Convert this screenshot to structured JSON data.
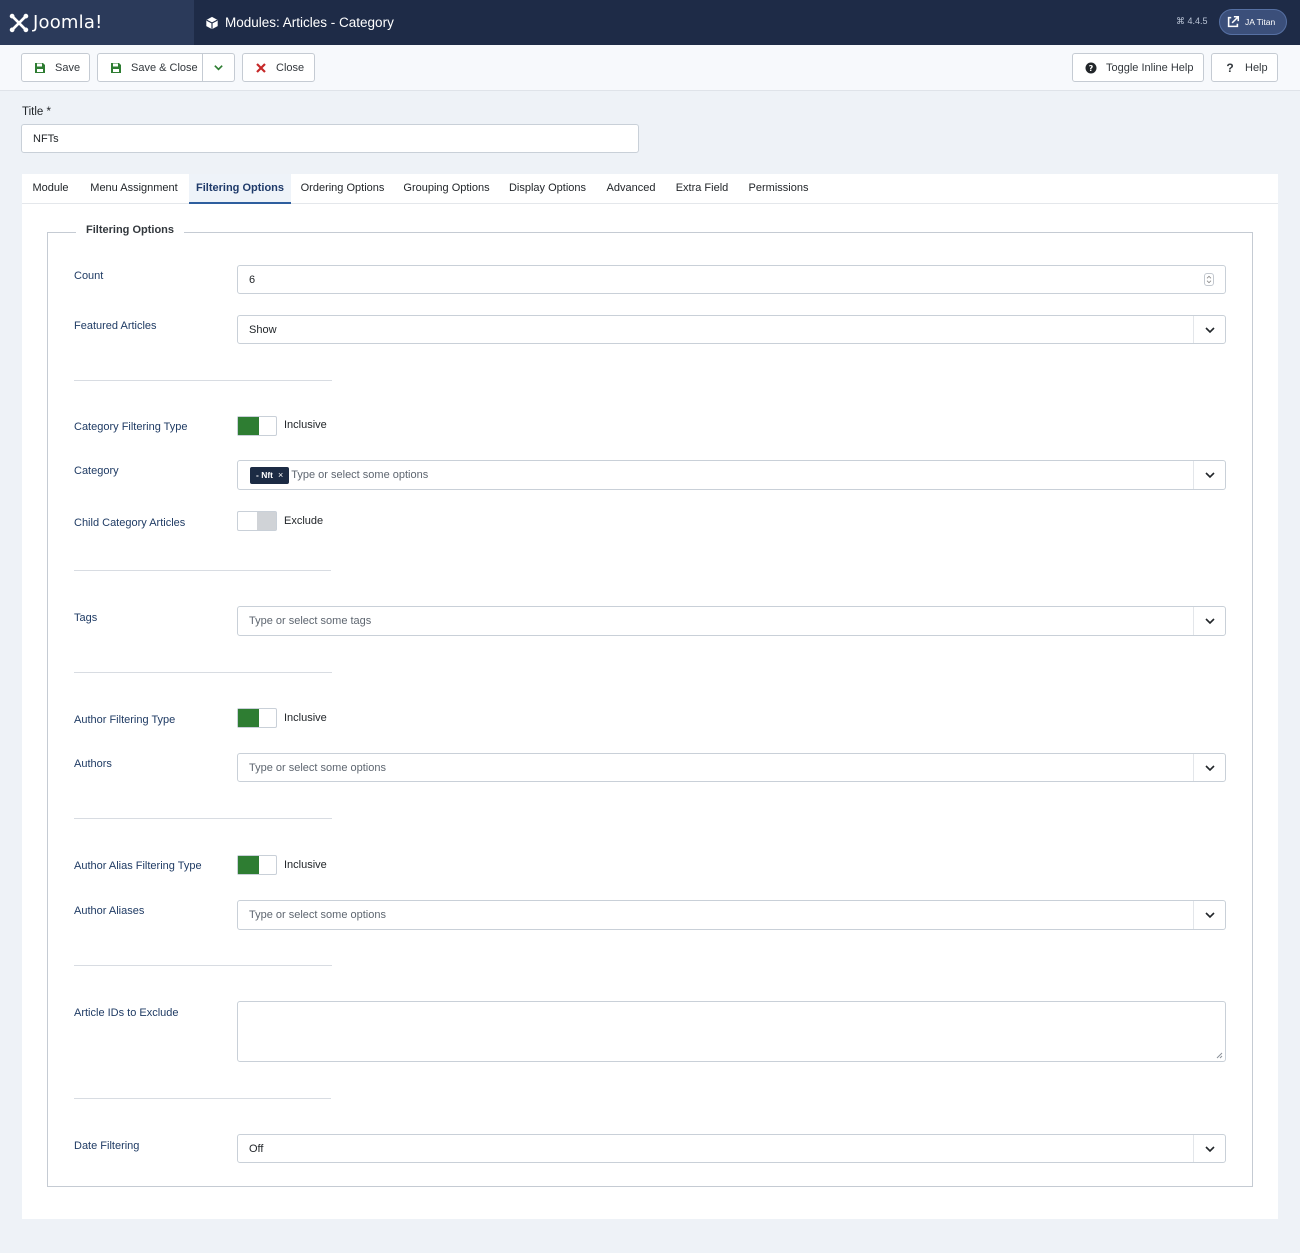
{
  "header": {
    "brand": "Joomla!",
    "page_title": "Modules: Articles - Category",
    "version": "⌘ 4.4.5",
    "user": "JA Titan"
  },
  "toolbar": {
    "save": "Save",
    "save_close": "Save & Close",
    "close": "Close",
    "toggle_help": "Toggle Inline Help",
    "help": "Help"
  },
  "title_field": {
    "label": "Title *",
    "value": "NFTs"
  },
  "tabs": [
    {
      "label": "Module"
    },
    {
      "label": "Menu Assignment"
    },
    {
      "label": "Filtering Options",
      "active": true
    },
    {
      "label": "Ordering Options"
    },
    {
      "label": "Grouping Options"
    },
    {
      "label": "Display Options"
    },
    {
      "label": "Advanced"
    },
    {
      "label": "Extra Field"
    },
    {
      "label": "Permissions"
    }
  ],
  "fieldset": {
    "legend": "Filtering Options",
    "count": {
      "label": "Count",
      "value": "6"
    },
    "featured": {
      "label": "Featured Articles",
      "value": "Show"
    },
    "category_filtering_type": {
      "label": "Category Filtering Type",
      "state": "Inclusive"
    },
    "category": {
      "label": "Category",
      "chip": "- Nft",
      "chip_remove": "×",
      "placeholder": "Type or select some options"
    },
    "child_category": {
      "label": "Child Category Articles",
      "state": "Exclude"
    },
    "tags": {
      "label": "Tags",
      "placeholder": "Type or select some tags"
    },
    "author_filtering_type": {
      "label": "Author Filtering Type",
      "state": "Inclusive"
    },
    "authors": {
      "label": "Authors",
      "placeholder": "Type or select some options"
    },
    "author_alias_filtering_type": {
      "label": "Author Alias Filtering Type",
      "state": "Inclusive"
    },
    "author_aliases": {
      "label": "Author Aliases",
      "placeholder": "Type or select some options"
    },
    "article_ids": {
      "label": "Article IDs to Exclude",
      "value": ""
    },
    "date_filtering": {
      "label": "Date Filtering",
      "value": "Off"
    }
  },
  "colors": {
    "header_bg": "#1e2b47",
    "toggle_on": "#2e7d32",
    "link_label": "#1f3b64"
  }
}
